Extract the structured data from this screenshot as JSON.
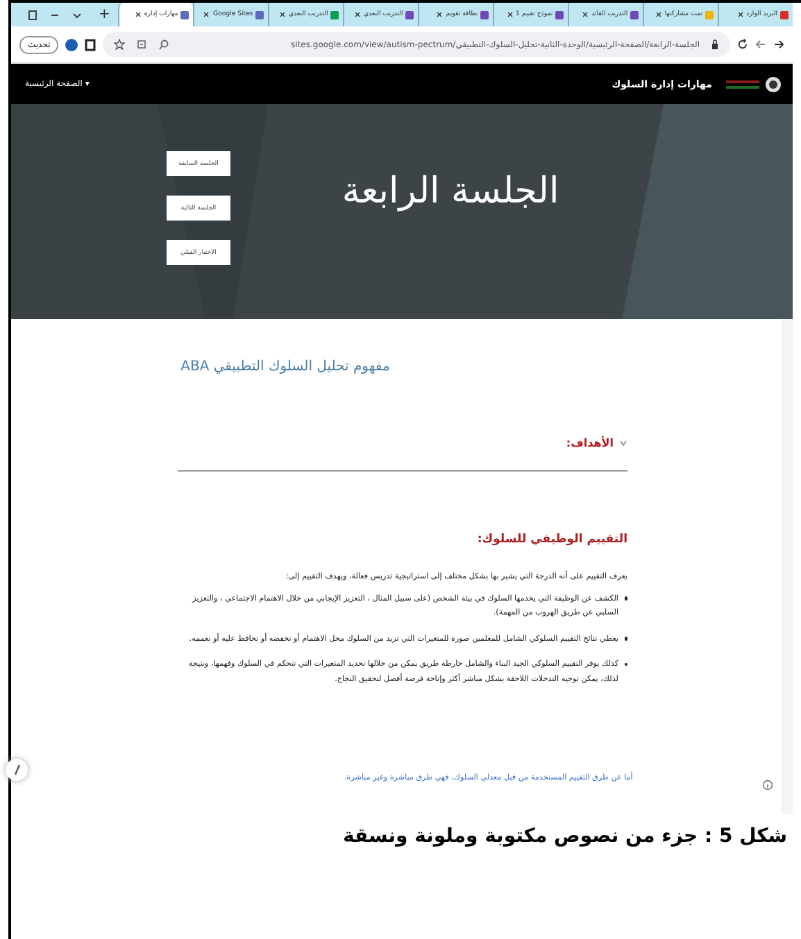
{
  "browser": {
    "tabs": [
      {
        "label": "البريد الوارد",
        "selected": false,
        "color": "#d93025"
      },
      {
        "label": "تمت مشاركتها",
        "selected": false,
        "color": "#f4b400"
      },
      {
        "label": "التدريب القائد",
        "selected": false,
        "color": "#7248b9"
      },
      {
        "label": "نموذج تقييم 1",
        "selected": false,
        "color": "#7248b9"
      },
      {
        "label": "بطاقة تقويم",
        "selected": false,
        "color": "#7248b9"
      },
      {
        "label": "التدريب البعدي",
        "selected": false,
        "color": "#7248b9"
      },
      {
        "label": "التدريب البعدي",
        "selected": false,
        "color": "#0f9d58"
      },
      {
        "label": "Google Sites",
        "selected": false,
        "color": "#5c6bc0"
      },
      {
        "label": "مهارات إدارة",
        "selected": true,
        "color": "#5c6bc0"
      }
    ],
    "new_tab": "+",
    "url": "sites.google.com/view/autism-pectrum/الجلسة-الرابعة/الصفحة-الرئيسية/الوحدة-الثانية-تحليل-السلوك-التطبيقي",
    "update_button": "تحديث"
  },
  "site": {
    "title": "مهارات إدارة السلوك",
    "menu": "الصفحة الرئيسية ▾"
  },
  "hero": {
    "title": "الجلسة الرابعة",
    "buttons": [
      "الجلسة السابقة",
      "الجلسة التالية",
      "الاختبار القبلي"
    ]
  },
  "content": {
    "heading": "مفهوم تحليل السلوك التطبيقي ABA",
    "section": {
      "label": "الأهداف:",
      "expanded": false
    },
    "subheading": "التقييم الوظيفي للسلوك:",
    "intro": "يعرف التقييم على أنه الدرجة التي يشير بها بشكل مختلف إلى استراتيجية تدريس فعالة، ويهدف التقييم إلى:",
    "bullets": [
      "الكشف عن الوظيفة التي يخدمها السلوك في بيئة الشخص (على سبيل المثال ، التعزيز الإيجابي من خلال الاهتمام الاجتماعي ، والتعزيز السلبي عن طريق الهروب من المهمة).",
      "يعطي نتائج التقييم السلوكي الشامل للمعلمين صورة للمتغيرات التي تزيد من السلوك محل الاهتمام أو تخفضه أو تحافظ عليه أو تعممه.",
      "كذلك يوفر التقييم السلوكي الجيد البناء والشامل خارطة طريق يمكن من خلالها تحديد المتغيرات التي تتحكم في السلوك وفهمها، ونتيجة لذلك، يمكن توجيه التدخلات اللاحقة بشكل مباشر أكثر وإتاحة فرصة أفضل لتحقيق النجاح."
    ],
    "link": "أما عن طرق التقييم المستخدمة من قبل معدلي السلوك، فهي طرق مباشرة وغير مباشرة."
  },
  "caption": "شكل 5 : جزء من نصوص مكتوبة وملونة ونسقة"
}
